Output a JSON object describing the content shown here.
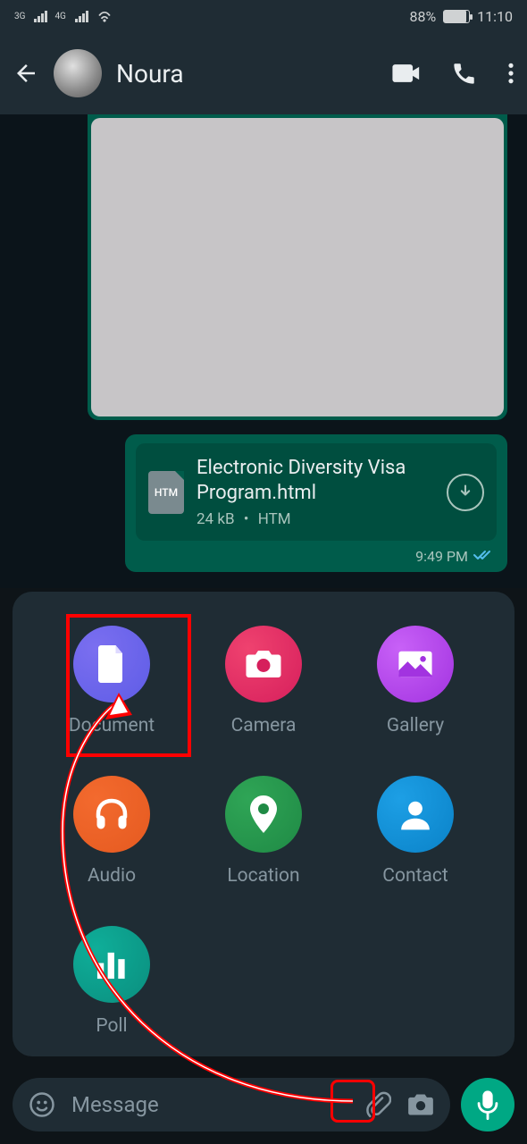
{
  "status": {
    "net1_label": "3G",
    "net2_label": "4G",
    "battery_pct": "88%",
    "time": "11:10"
  },
  "header": {
    "contact_name": "Noura"
  },
  "chat": {
    "doc_icon_label": "HTM",
    "doc_title": "Electronic Diversity Visa Program.html",
    "doc_size": "24 kB",
    "doc_ext": "HTM",
    "doc_sep": "•",
    "time": "9:49 PM"
  },
  "attach": {
    "document": "Document",
    "camera": "Camera",
    "gallery": "Gallery",
    "audio": "Audio",
    "location": "Location",
    "contact": "Contact",
    "poll": "Poll"
  },
  "input": {
    "placeholder": "Message"
  }
}
